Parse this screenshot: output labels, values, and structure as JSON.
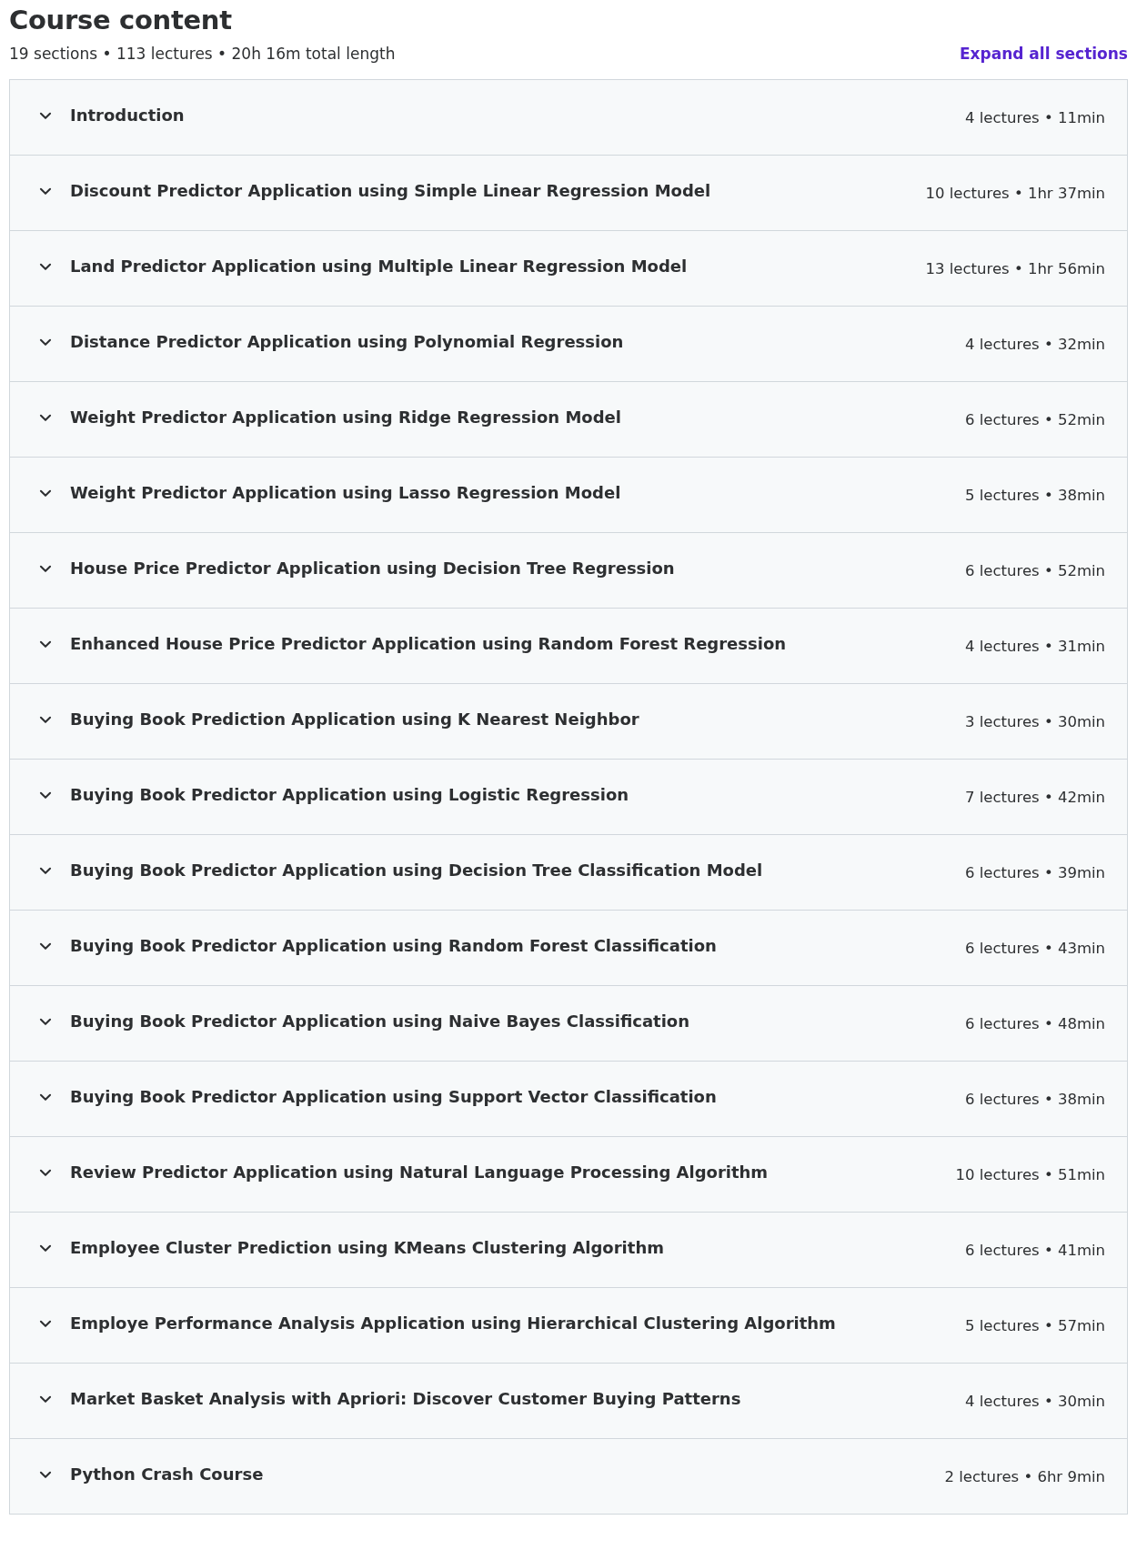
{
  "heading": "Course content",
  "summary": "19 sections • 113 lectures • 20h 16m total length",
  "expand_all": "Expand all sections",
  "sections": [
    {
      "title": "Introduction",
      "meta": "4 lectures • 11min",
      "expanded": false
    },
    {
      "title": "Discount Predictor Application using Simple Linear Regression Model",
      "meta": "10 lectures • 1hr 37min",
      "expanded": false
    },
    {
      "title": "Land Predictor Application using Multiple Linear Regression Model",
      "meta": "13 lectures • 1hr 56min",
      "expanded": false
    },
    {
      "title": "Distance Predictor Application using Polynomial Regression",
      "meta": "4 lectures • 32min",
      "expanded": false
    },
    {
      "title": "Weight Predictor Application using Ridge Regression Model",
      "meta": "6 lectures • 52min",
      "expanded": false
    },
    {
      "title": "Weight Predictor Application using Lasso Regression Model",
      "meta": "5 lectures • 38min",
      "expanded": false
    },
    {
      "title": "House Price Predictor Application using Decision Tree Regression",
      "meta": "6 lectures • 52min",
      "expanded": false
    },
    {
      "title": "Enhanced House Price Predictor Application using Random Forest Regression",
      "meta": "4 lectures • 31min",
      "expanded": false
    },
    {
      "title": "Buying Book Prediction Application using K Nearest Neighbor",
      "meta": "3 lectures • 30min",
      "expanded": false
    },
    {
      "title": "Buying Book Predictor Application using Logistic Regression",
      "meta": "7 lectures • 42min",
      "expanded": false
    },
    {
      "title": "Buying Book Predictor Application using Decision Tree Classification Model",
      "meta": "6 lectures • 39min",
      "expanded": false
    },
    {
      "title": "Buying Book Predictor Application using Random Forest Classification",
      "meta": "6 lectures • 43min",
      "expanded": false
    },
    {
      "title": "Buying Book Predictor Application using Naive Bayes Classification",
      "meta": "6 lectures • 48min",
      "expanded": false
    },
    {
      "title": "Buying Book Predictor Application using Support Vector Classification",
      "meta": "6 lectures • 38min",
      "expanded": false
    },
    {
      "title": "Review Predictor Application using Natural Language Processing Algorithm",
      "meta": "10 lectures • 51min",
      "expanded": false
    },
    {
      "title": "Employee Cluster Prediction using KMeans Clustering Algorithm",
      "meta": "6 lectures • 41min",
      "expanded": false
    },
    {
      "title": "Employe Performance Analysis Application using Hierarchical Clustering Algorithm",
      "meta": "5 lectures • 57min",
      "expanded": false
    },
    {
      "title": "Market Basket Analysis with Apriori: Discover Customer Buying Patterns",
      "meta": "4 lectures • 30min",
      "expanded": false
    },
    {
      "title": "Python Crash Course",
      "meta": "2 lectures • 6hr 9min",
      "expanded": false
    }
  ]
}
